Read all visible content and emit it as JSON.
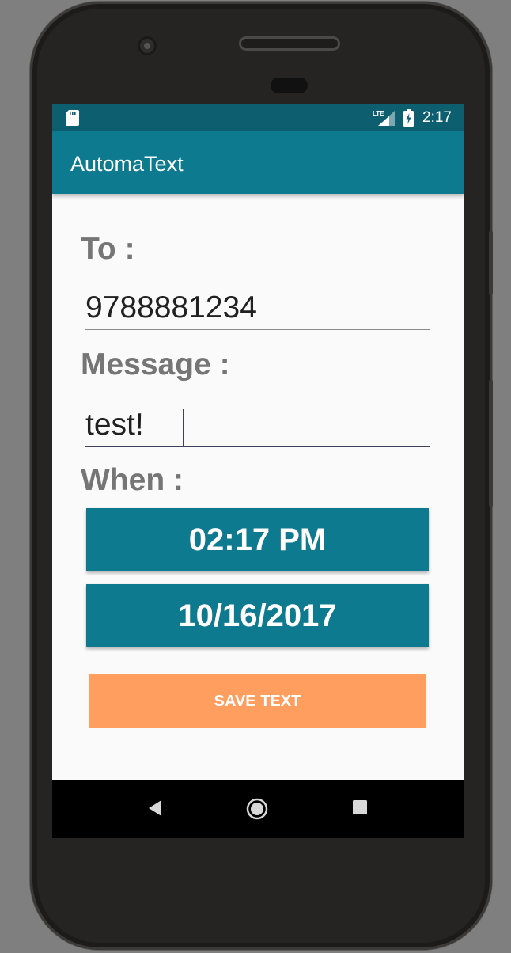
{
  "status_bar": {
    "time": "2:17",
    "network": "LTE",
    "icons": [
      "sd-card-icon",
      "lte-signal-icon",
      "battery-charging-icon"
    ]
  },
  "app_bar": {
    "title": "AutomaText",
    "color": "#0e7a8f"
  },
  "form": {
    "to_label": "To :",
    "to_value": "9788881234",
    "message_label": "Message :",
    "message_value": "test!",
    "when_label": "When :",
    "time_button": "02:17 PM",
    "date_button": "10/16/2017",
    "save_button": "SAVE TEXT"
  },
  "colors": {
    "primary": "#0e7a8f",
    "primary_dark": "#0d5f6f",
    "accent": "#ff9e5e",
    "label": "#757575"
  },
  "nav_bar": {
    "icons": [
      "back-icon",
      "home-icon",
      "recents-icon"
    ]
  }
}
